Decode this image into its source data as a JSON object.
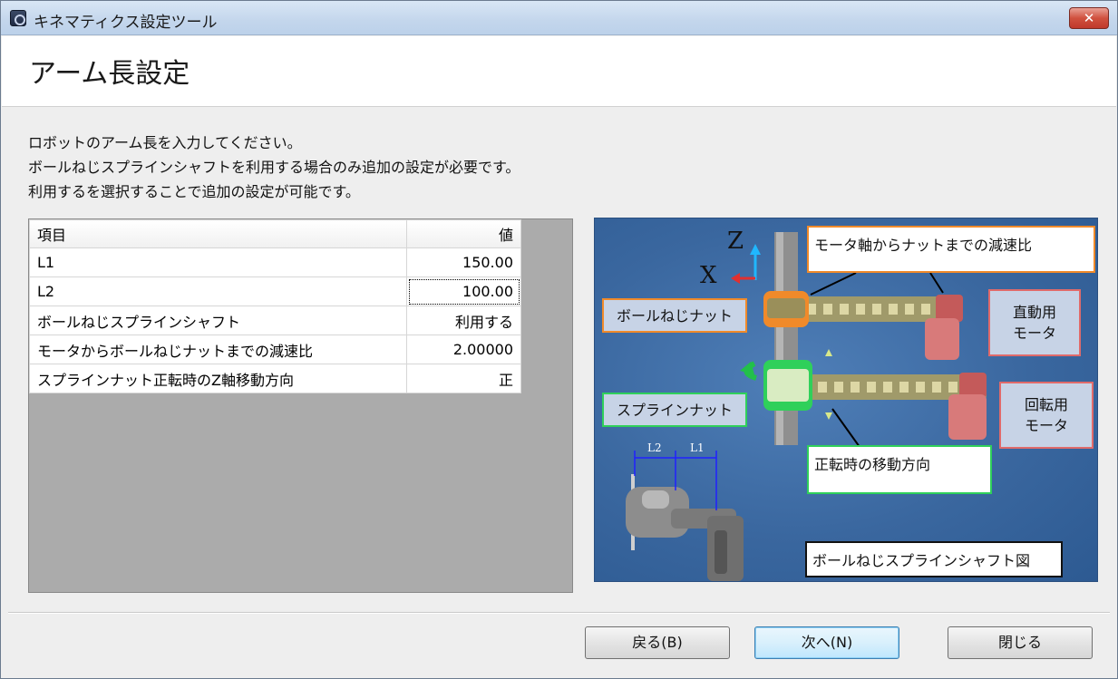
{
  "window": {
    "title": "キネマティクス設定ツール",
    "close_label": "✕"
  },
  "header": {
    "title": "アーム長設定"
  },
  "instructions": [
    "ロボットのアーム長を入力してください。",
    "ボールねじスプラインシャフトを利用する場合のみ追加の設定が必要です。",
    "利用するを選択することで追加の設定が可能です。"
  ],
  "grid": {
    "columns": [
      "項目",
      "値"
    ],
    "rows": [
      {
        "item": "L1",
        "value": "150.00"
      },
      {
        "item": "L2",
        "value": "100.00"
      },
      {
        "item": "ボールねじスプラインシャフト",
        "value": "利用する"
      },
      {
        "item": "モータからボールねじナットまでの減速比",
        "value": "2.00000"
      },
      {
        "item": "スプラインナット正転時のZ軸移動方向",
        "value": "正"
      }
    ]
  },
  "diagram": {
    "axis_z": "Z",
    "axis_x": "X",
    "callout_reduction": "モータ軸からナットまでの減速比",
    "ballscrew_nut": "ボールねじナット",
    "linear_motor_line1": "直動用",
    "linear_motor_line2": "モータ",
    "spline_nut": "スプラインナット",
    "rotation_motor_line1": "回転用",
    "rotation_motor_line2": "モータ",
    "callout_direction": "正転時の移動方向",
    "arm_l2": "L2",
    "arm_l1": "L1",
    "caption": "ボールねじスプラインシャフト図",
    "colors": {
      "background": "#3a679f",
      "belt": "#a09a6a",
      "motor": "#d87a7a",
      "nut_orange": "#f08a2a",
      "nut_green": "#2fd05a"
    }
  },
  "footer": {
    "back_label": "戻る(B)",
    "next_label": "次へ(N)",
    "close_label": "閉じる"
  }
}
